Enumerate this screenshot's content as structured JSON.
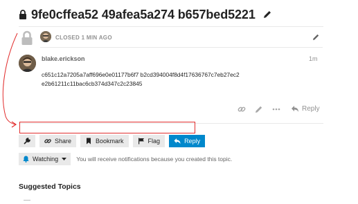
{
  "topic": {
    "title": "9fe0cffea52 49afea5a274 b657bed5221"
  },
  "closed_notice": {
    "text": "CLOSED 1 MIN AGO"
  },
  "post": {
    "username": "blake.erickson",
    "time": "1m",
    "body_lines": [
      "c651c12a7205a7aff696e0e01177b6f7 b2cd394004f8d4f17636767c7eb27ec2",
      "e2b61211c11bac6cb374d347c2c23845"
    ],
    "reply_label": "Reply"
  },
  "footer_buttons": {
    "share": "Share",
    "bookmark": "Bookmark",
    "flag": "Flag",
    "reply": "Reply"
  },
  "notifications": {
    "level": "Watching",
    "description": "You will receive notifications because you created this topic."
  },
  "suggested": {
    "heading": "Suggested Topics"
  },
  "colors": {
    "primary": "#0088cc",
    "annotation": "#e12c2c",
    "muted": "#919191"
  },
  "icons": [
    "lock-icon",
    "pencil-icon",
    "link-icon",
    "ellipsis-icon",
    "reply-icon",
    "wrench-icon",
    "bookmark-icon",
    "flag-icon",
    "bell-icon",
    "caret-down-icon"
  ]
}
